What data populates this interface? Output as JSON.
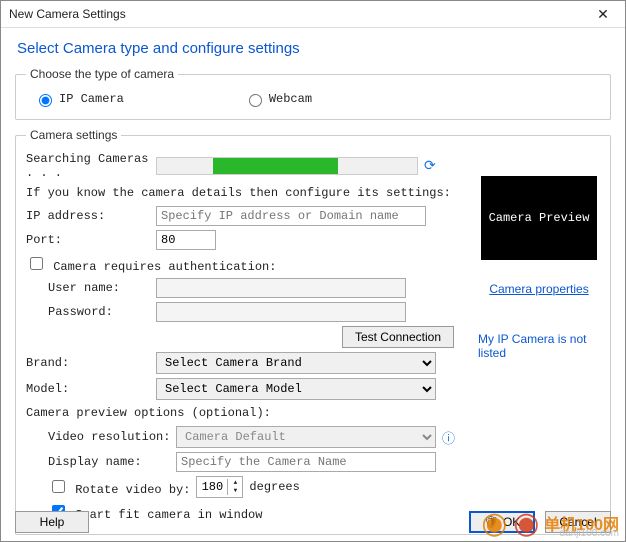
{
  "window_title": "New Camera Settings",
  "heading": "Select Camera type and configure settings",
  "groups": {
    "camera_type_legend": "Choose the type of camera",
    "camera_settings_legend": "Camera settings"
  },
  "camera_type": {
    "ip_camera": "IP Camera",
    "webcam": "Webcam"
  },
  "search_label": "Searching Cameras . . .",
  "known_hint": "If you know the camera details then configure its settings:",
  "fields": {
    "ip_label": "IP address:",
    "ip_placeholder": "Specify IP address or Domain name",
    "port_label": "Port:",
    "port_value": "80",
    "auth_label": "Camera requires authentication:",
    "user_label": "User name:",
    "password_label": "Password:",
    "brand_label": "Brand:",
    "brand_option": "Select Camera Brand",
    "model_label": "Model:",
    "model_option": "Select Camera Model",
    "preview_opts_label": "Camera preview options (optional):",
    "video_res_label": "Video resolution:",
    "video_res_option": "Camera Default",
    "display_name_label": "Display name:",
    "display_name_placeholder": "Specify the Camera Name",
    "rotate_label": "Rotate video by:",
    "rotate_value": "180",
    "rotate_suffix": "degrees",
    "smartfit_label": "Smart fit camera in window"
  },
  "buttons": {
    "test": "Test Connection",
    "help": "Help",
    "ok": "OK",
    "cancel": "Cancel"
  },
  "preview": {
    "text": "Camera Preview",
    "props_link": "Camera properties",
    "not_listed_link": "My IP Camera is not listed"
  },
  "watermark": {
    "text": "单机100网",
    "sub": "danji100.com"
  }
}
